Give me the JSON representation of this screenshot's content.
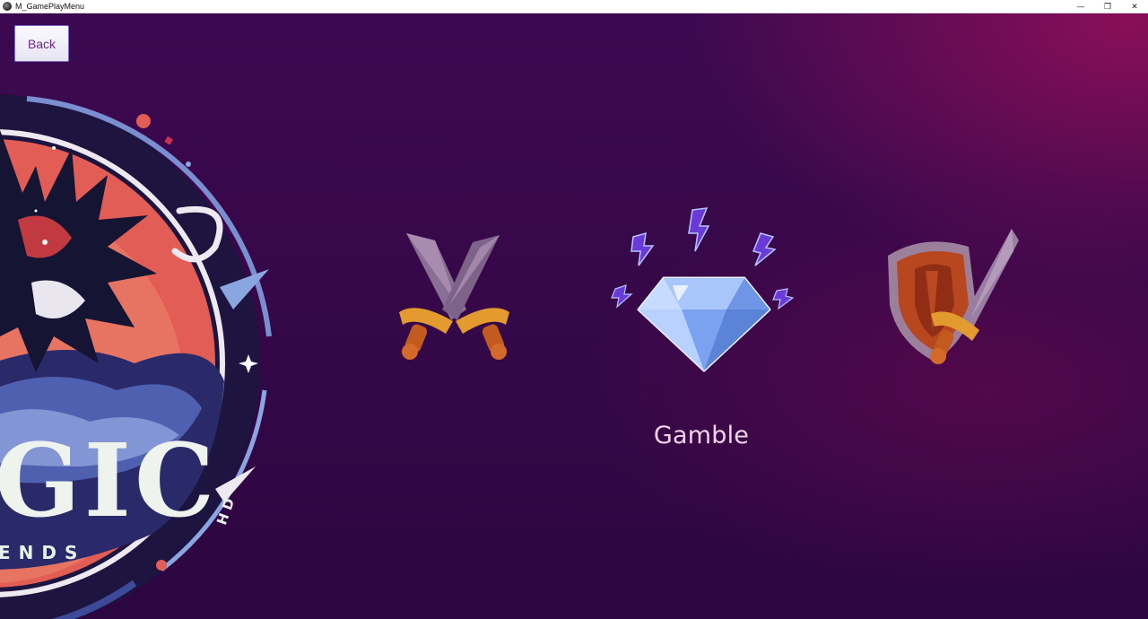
{
  "window": {
    "title": "M_GamePlayMenu",
    "controls": {
      "minimize": "—",
      "restore": "❐",
      "close": "✕"
    }
  },
  "toolbar": {
    "back_label": "Back"
  },
  "logo": {
    "text_line1": "GIC",
    "text_line2": "ENDS",
    "side_text": "HD"
  },
  "modes": [
    {
      "icon": "crossed-swords-icon"
    },
    {
      "icon": "diamond-icon",
      "label": "Gamble"
    },
    {
      "icon": "shield-sword-icon"
    }
  ],
  "colors": {
    "background": "#360849",
    "accent_magenta": "#960f5a",
    "label_text": "#f2d3ea",
    "button_text": "#6a2a86"
  }
}
